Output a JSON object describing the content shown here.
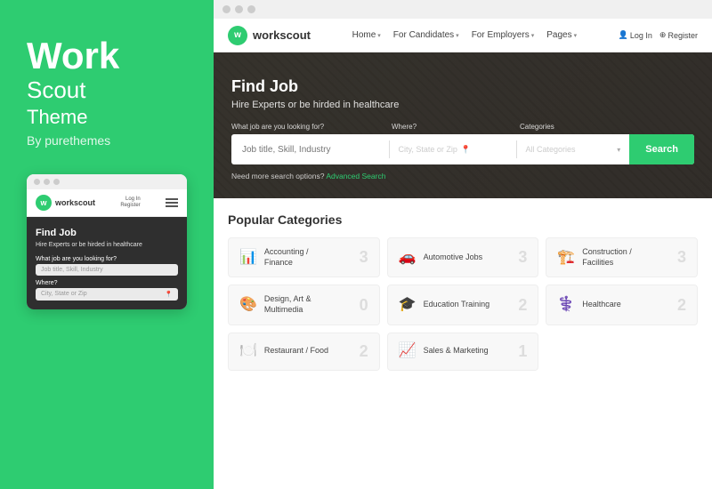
{
  "left": {
    "title_line1": "Work",
    "title_line2": "Scout",
    "subtitle": "Theme",
    "by": "By purethemes",
    "mobile": {
      "logo_letter": "w",
      "logo_name": "workscout",
      "nav_login": "Log In",
      "nav_register": "Register",
      "hero_title": "Find Job",
      "hero_sub": "Hire Experts or be hirded in healthcare",
      "search_label": "What job are you looking for?",
      "search_placeholder": "Job title, Skill, Industry",
      "where_label": "Where?",
      "where_placeholder": "City, State or Zip"
    }
  },
  "browser": {
    "dots": [
      "dot1",
      "dot2",
      "dot3"
    ]
  },
  "site": {
    "logo_letter": "w",
    "logo_name": "workscout",
    "nav": [
      {
        "label": "Home",
        "has_arrow": true
      },
      {
        "label": "For Candidates",
        "has_arrow": true
      },
      {
        "label": "For Employers",
        "has_arrow": true
      },
      {
        "label": "Pages",
        "has_arrow": true
      }
    ],
    "actions": [
      {
        "icon": "👤",
        "label": "Log In"
      },
      {
        "icon": "⊕",
        "label": "Register"
      }
    ]
  },
  "hero": {
    "title": "Find Job",
    "subtitle": "Hire Experts or be hirded in healthcare",
    "search_labels": [
      "What job are you looking for?",
      "Where?",
      "Categories"
    ],
    "search_placeholder": "Job title, Skill, Industry",
    "location_placeholder": "City, State or Zip",
    "category_placeholder": "All Categories",
    "search_button": "Search",
    "advanced_prefix": "Need more search options?",
    "advanced_link": "Advanced Search"
  },
  "categories": {
    "title": "Popular Categories",
    "items": [
      {
        "icon": "📊",
        "name": "Accounting /\nFinance",
        "count": "3"
      },
      {
        "icon": "🚗",
        "name": "Automotive Jobs",
        "count": "3"
      },
      {
        "icon": "🏗️",
        "name": "Construction /\nFacilities",
        "count": "3"
      },
      {
        "icon": "🎨",
        "name": "Design, Art &\nMultimedia",
        "count": "0"
      },
      {
        "icon": "🎓",
        "name": "Education Training",
        "count": "2"
      },
      {
        "icon": "⚕️",
        "name": "Healthcare",
        "count": "2"
      },
      {
        "icon": "🍽️",
        "name": "Restaurant / Food",
        "count": "2"
      },
      {
        "icon": "📈",
        "name": "Sales & Marketing",
        "count": "1"
      }
    ]
  }
}
